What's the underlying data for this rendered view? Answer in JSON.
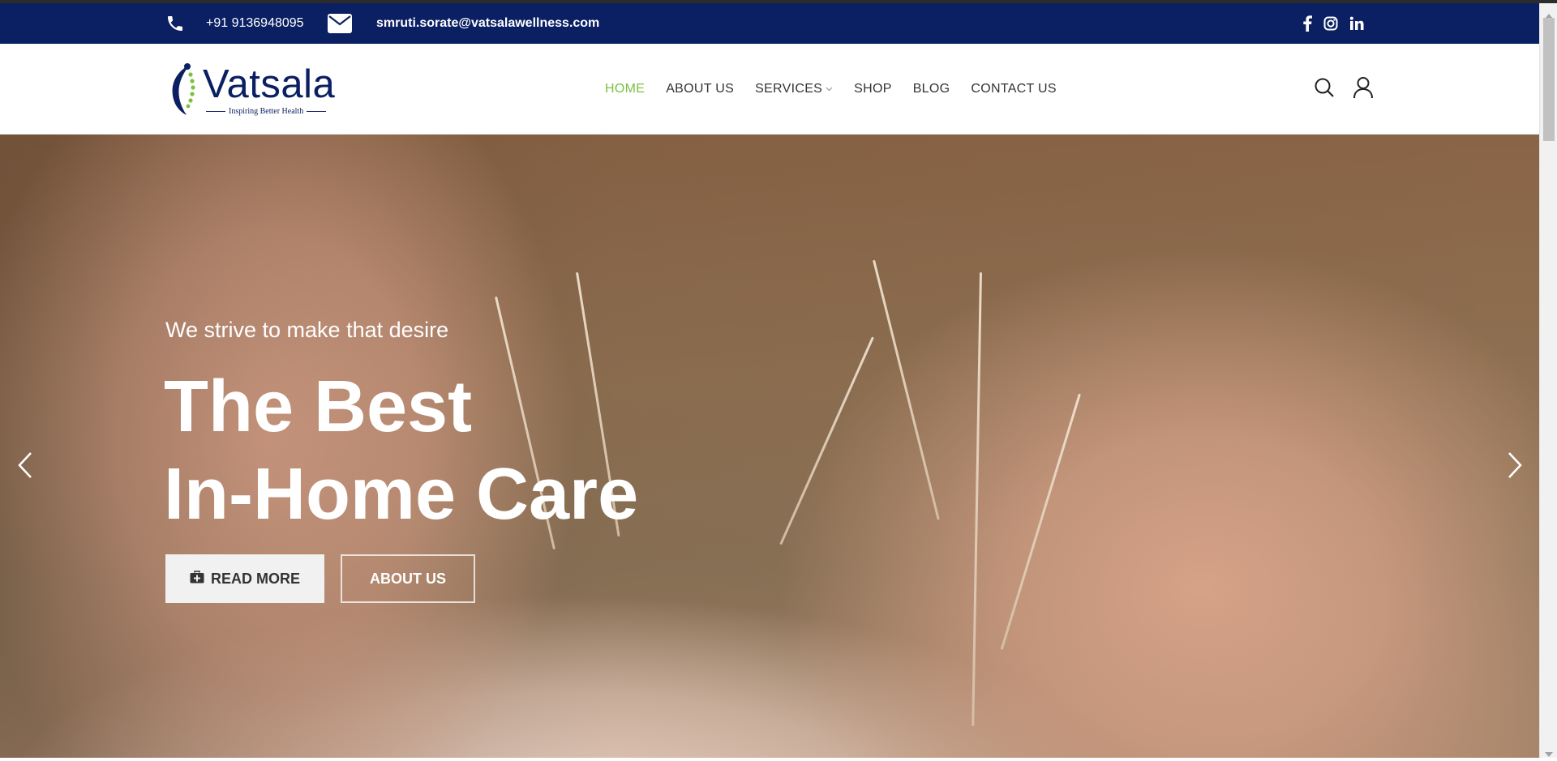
{
  "colors": {
    "topbar_bg": "#0b1f63",
    "nav_active": "#7ac142",
    "nav_text": "#333333",
    "logo_blue": "#0b1f63",
    "logo_green": "#7ac142"
  },
  "topbar": {
    "phone_icon": "phone-icon",
    "phone": "+91 9136948095",
    "email_icon": "mail-icon",
    "email": "smruti.sorate@vatsalawellness.com",
    "social_icons": [
      "facebook-icon",
      "instagram-icon",
      "linkedin-icon"
    ]
  },
  "header": {
    "logo_text": "Vatsala",
    "logo_tagline": "Inspiring Better Health",
    "nav": [
      {
        "label": "HOME",
        "active": true
      },
      {
        "label": "ABOUT US",
        "active": false
      },
      {
        "label": "SERVICES",
        "active": false,
        "has_dropdown": true
      },
      {
        "label": "SHOP",
        "active": false
      },
      {
        "label": "BLOG",
        "active": false
      },
      {
        "label": "CONTACT US",
        "active": false
      }
    ],
    "icons": [
      "search-icon",
      "user-icon"
    ]
  },
  "hero": {
    "subtitle": "We strive to make that desire",
    "title_line1": "The Best",
    "title_line2": "In-Home Care",
    "primary_button": "READ MORE",
    "primary_button_icon": "medical-kit-icon",
    "secondary_button": "ABOUT US",
    "prev_icon": "chevron-left-icon",
    "next_icon": "chevron-right-icon"
  }
}
